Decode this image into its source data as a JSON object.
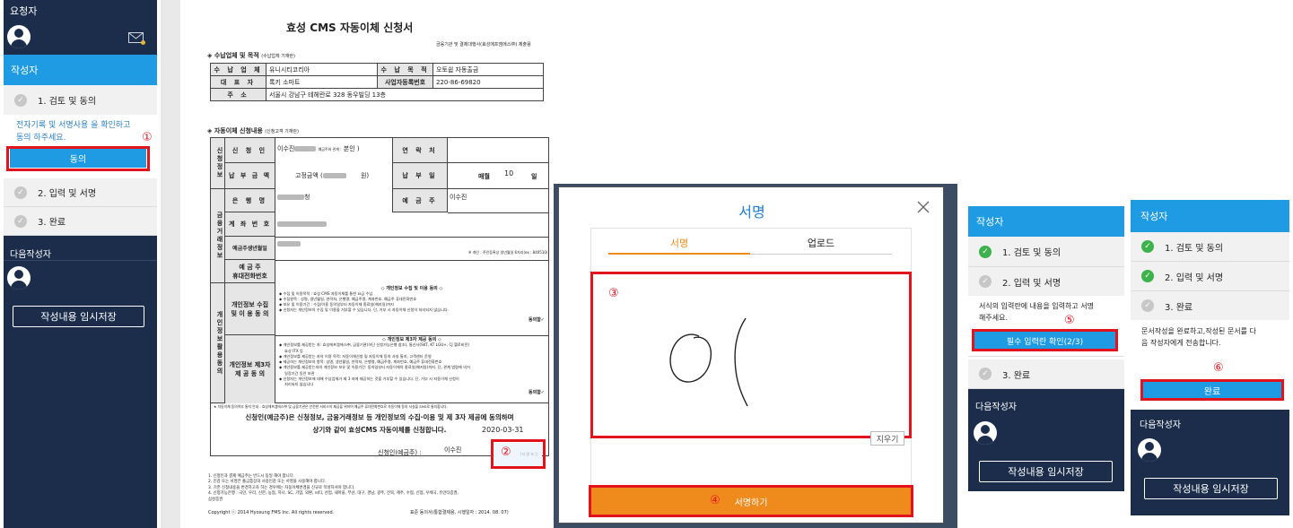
{
  "colors": {
    "navy": "#1b2d4a",
    "blue": "#1e9be3",
    "orange": "#ef8a1c",
    "red": "#e3131e",
    "green": "#3db14b"
  },
  "left_sidebar": {
    "requester_label": "요청자",
    "author_header": "작성자",
    "step1": "1. 검토 및 동의",
    "step1_desc_line1": "전자기록 및 서명사용 을 확인하고",
    "step1_desc_line2": "동의 하주세요.",
    "agree_button": "동의",
    "step2": "2. 입력 및 서명",
    "step3": "3. 완료",
    "next_author": "다음작성자",
    "save_button": "작성내용 임시저장"
  },
  "document": {
    "title": "효성 CMS 자동이체  신청서",
    "issuer": "금융기관 및 결제대행사(효성에프엠에스㈜) 제출용",
    "section1": "◈ 수납업체 및 목적",
    "section1_note": "(수납업체 기재란)",
    "biz": {
      "name_label": "수 납 업 체",
      "name_value": "유니시티코리아",
      "purpose_label": "수 납 목 적",
      "purpose_value": "오토쉽 자동출금",
      "rep_label": "대 표 자",
      "rep_value": "록키 소마트",
      "regno_label": "사업자등록번호",
      "regno_value": "220-86-69820",
      "addr_label": "주 소",
      "addr_value": "서울시 강남구 테헤란로 328 동우빌딩 13층"
    },
    "section2": "◈ 자동이체 신청내용",
    "section2_note": "(신청고객 기재란)",
    "applicant": {
      "group_label": "신청정보",
      "name_label": "신 청 인",
      "name_value": "이수진",
      "relation_label": "예금주와 관계 :",
      "relation_value": "본인",
      "contact_label": "연 락 처",
      "amount_label": "납 부 금 액",
      "amount_prefix": "고정금액 (",
      "amount_suffix": "원)",
      "payday_label": "납 부 일",
      "payday_prefix": "매월",
      "payday_value": "10",
      "payday_suffix": "일",
      "fin_group_label": "금융거래정보",
      "bank_label": "은 행 명",
      "bank_value": "청",
      "holder_label": "예 금 주",
      "holder_value": "이수진",
      "account_label": "계 좌 번 호",
      "birth_label": "예금주생년월일",
      "birth_note": "※ 개인 : 주민등록상 생년월일 6자리(ex : 840510)",
      "phone_label_1": "예 금 주",
      "phone_label_2": "휴대전화번호"
    },
    "privacy": {
      "group_label": "개인정보활용동의",
      "consent1_label": "개인정보 수집 및 이 용 동 의",
      "consent1_title": "◇ 개인정보 수집 및 이용 동의 ◇",
      "consent1_items": [
        "수집 및 이용목적 : 효성 CMS 자동이체를 통한 요금 수납",
        "수집항목 : 성명, 생년월일, 연락처, 은행명, 예금주명, 계좌번호, 예금주 휴대전화번호",
        "보유 및 이용기간 : 수집/이용 동의일부터 자동이체 종료일(해지일)까지",
        "신청자는 개인정보의 수집 및 이용을 거부할 수 있습니다. 단, 거부 시 자동이체 신청이 처리되지 않습니다."
      ],
      "agree_mark": "동의함✓",
      "consent2_label": "개인정보 제3자 제 공 동 의",
      "consent2_title": "◇ 개인정보 제3자 제공 동의 ◇",
      "consent2_items": [
        "개인정보를 제공받는 자: 효성에프엠에스㈜, 금융기관(하단 신청가능은행 참조), 통신사(SKT, KT LGU+, CJ 헬로비전)",
        "효성 ITX 등",
        "개인정보를 제공받는 자의 이용 목적: 자동이체신청 및 자동이체 동의 사실 통지, 고객센터 운영",
        "제공하는 개인정보의 항목: 성명, 생년월일, 연락처, 은행명, 예금주명, 계좌번호, 예금주 휴대전화번호",
        "개인정보를 제공받는자의 개인정보 보유 및 이용기간: 동의일부터 자동이체의 종료일(해지일)까지. 단, 관계 법령에 의거",
        "일정기간 동안 보관",
        "신청자는 개인정보에 대해 수납업체가 제 3 자에 제공하는 것을 거부할 수 있습니다. 단, 거부 시 자동이체 신청이",
        "처리되지 않습니다"
      ]
    },
    "footnote": "★ 자동이체 동의여부 통지 안내 : 효성에프엠에스㈜ 및 금융기관은 안전한 서비스의 제공을 위하여 예금주 휴대전화번호로 자동이체 동의 사실을 SMS로 통지합니다.",
    "statement_line1": "신청인(예금주)은 신청정보, 금융거래정보 등 개인정보의 수집·이용 및 제 3자 제공에 동의하며",
    "statement_line2": "상기와 같이 효성CMS 자동이체를 신청합니다.",
    "date": "2020-03-31",
    "sign_label": "신청인(예금주) :",
    "sign_name": "이수진",
    "sign_placeholder": "(서 명 또 는",
    "notes": [
      "1. 신청인과 결제 예금주는 반드시 동일 해야 합니다.",
      "2. 인감 또는 서명은 출금통장의 사용인감 또는 서명을 사용해야 합니다.",
      "3. 기존 신청내용을 변경하고자 하는 경우에는 자동이체변경을 신규로 작성하셔야 합니다.",
      "4. 신청가능은행 : 국민, 우리, 신한, 농협, 하나, SC, 기업, 외환, 씨티, 산업, 새마을, 부산, 대구, 경남, 광주, 전북, 제주, 수협, 신협, 우체국, 유안타증권,",
      "삼성증권"
    ],
    "copyright": "Copyright ⓒ 2014 Hyosung FMS Inc. All rights reserved.",
    "form_no": "표준 동의서(통합결제용, 시행일자 : 2014. 08. 07)"
  },
  "sign_modal": {
    "title": "서명",
    "tab_sign": "서명",
    "tab_upload": "업로드",
    "signature_text": "이",
    "clear_button": "지우기",
    "submit_button": "서명하기"
  },
  "panel2": {
    "author_header": "작성자",
    "step1": "1. 검토 및 동의",
    "step2": "2. 입력 및 서명",
    "step2_desc_line1": "서식의 입력란에 내용을 입력하고 서명",
    "step2_desc_line2": "해주세요.",
    "required_button": "필수 입력란 확인(2/3)",
    "step3": "3. 완료",
    "next_author": "다음작성자",
    "save_button": "작성내용 임시저장"
  },
  "panel3": {
    "author_header": "작성자",
    "step1": "1. 검토 및 동의",
    "step2": "2. 입력 및 서명",
    "step3": "3. 완료",
    "step3_desc_line1": "문서작성을 완료하고,작성된 문서를 다",
    "step3_desc_line2": "음 작성자에게 전송합니다.",
    "done_button": "완료",
    "next_author": "다음작성자",
    "save_button": "작성내용 임시저장"
  },
  "callouts": {
    "c1": "①",
    "c2": "②",
    "c3": "③",
    "c4": "④",
    "c5": "⑤",
    "c6": "⑥"
  }
}
